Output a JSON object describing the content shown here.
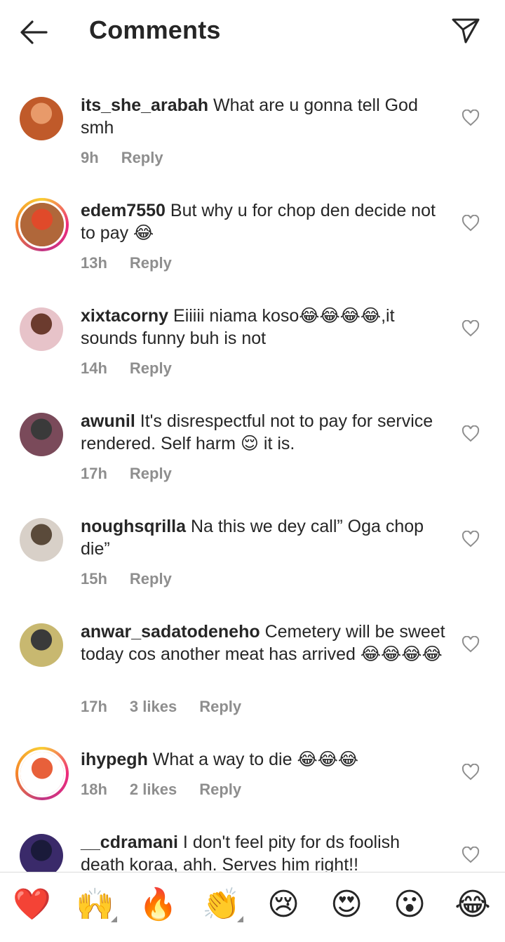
{
  "header": {
    "title": "Comments"
  },
  "reply_label": "Reply",
  "comments": [
    {
      "user": "its_she_arabah",
      "text": "What are u gonna tell God smh",
      "time": "9h",
      "likes": "",
      "avatar_colors": [
        "#c05a2a",
        "#e89a6a"
      ]
    },
    {
      "user": "edem7550",
      "text": "But why u for chop den decide not to pay 😂",
      "time": "13h",
      "likes": "",
      "avatar_colors": [
        "#b0673a",
        "#e04a2a"
      ]
    },
    {
      "user": "xixtacorny",
      "text": "Eiiiii niama koso😂😂😂😂,it sounds funny  buh is not",
      "time": "14h",
      "likes": "",
      "avatar_colors": [
        "#e7c3c9",
        "#6b3b2e"
      ]
    },
    {
      "user": "awunil",
      "text": "It's disrespectful not to pay for service rendered. Self harm 😌 it is.",
      "time": "17h",
      "likes": "",
      "avatar_colors": [
        "#7a4a5a",
        "#3a3a3a"
      ]
    },
    {
      "user": "noughsqrilla",
      "text": "Na this we dey call” Oga chop die”",
      "time": "15h",
      "likes": "",
      "avatar_colors": [
        "#d8d0c8",
        "#5a4a3a"
      ]
    },
    {
      "user": "anwar_sadatodeneho",
      "text": "Cemetery will be sweet today cos another meat has arrived 😂😂😂😂",
      "time": "17h",
      "likes": "3 likes",
      "avatar_colors": [
        "#c8b870",
        "#3a3a3a"
      ]
    },
    {
      "user": "ihypegh",
      "text": "What a way to die 😂😂😂",
      "time": "18h",
      "likes": "2 likes",
      "avatar_colors": [
        "#ffffff",
        "#e8603a"
      ]
    },
    {
      "user": "__cdramani",
      "text": "I don't feel pity for ds foolish death koraa, ahh. Serves him right!!",
      "time": "",
      "likes": "",
      "avatar_colors": [
        "#3a2a6a",
        "#1a1a3a"
      ]
    }
  ],
  "emoji_bar": [
    "❤️",
    "🙌",
    "🔥",
    "👏",
    "😢",
    "😍",
    "😮",
    "😂"
  ],
  "colors": {
    "text": "#262626",
    "muted": "#8e8e8e",
    "heart_red": "#ed4956"
  }
}
